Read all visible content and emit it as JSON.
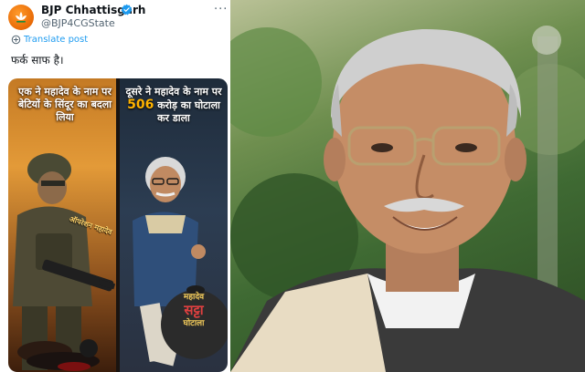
{
  "post": {
    "display_name": "BJP Chhattisgarh",
    "handle": "@BJP4CGState",
    "translate_label": "Translate post",
    "text": "फर्क साफ है।",
    "more_label": "···"
  },
  "media": {
    "left_caption": "एक ने महादेव के नाम पर बेटियों के सिंदूर का बदला लिया",
    "right_caption_lead": "दूसरे ने महादेव के नाम पर",
    "right_caption_number": "506",
    "right_caption_tail": "करोड़ का घोटाला कर डाला",
    "weapon_label": "ऑपरेशन महादेव",
    "bag_line1": "महादेव",
    "bag_line2": "सट्टा",
    "bag_line3": "घोटाला"
  },
  "colors": {
    "brand_orange": "#e86a06",
    "verified_blue": "#1d9bf0",
    "link_blue": "#1d9bf0"
  },
  "icons": {
    "verified": "verified-badge-icon",
    "translate": "translate-icon",
    "more": "more-icon"
  }
}
